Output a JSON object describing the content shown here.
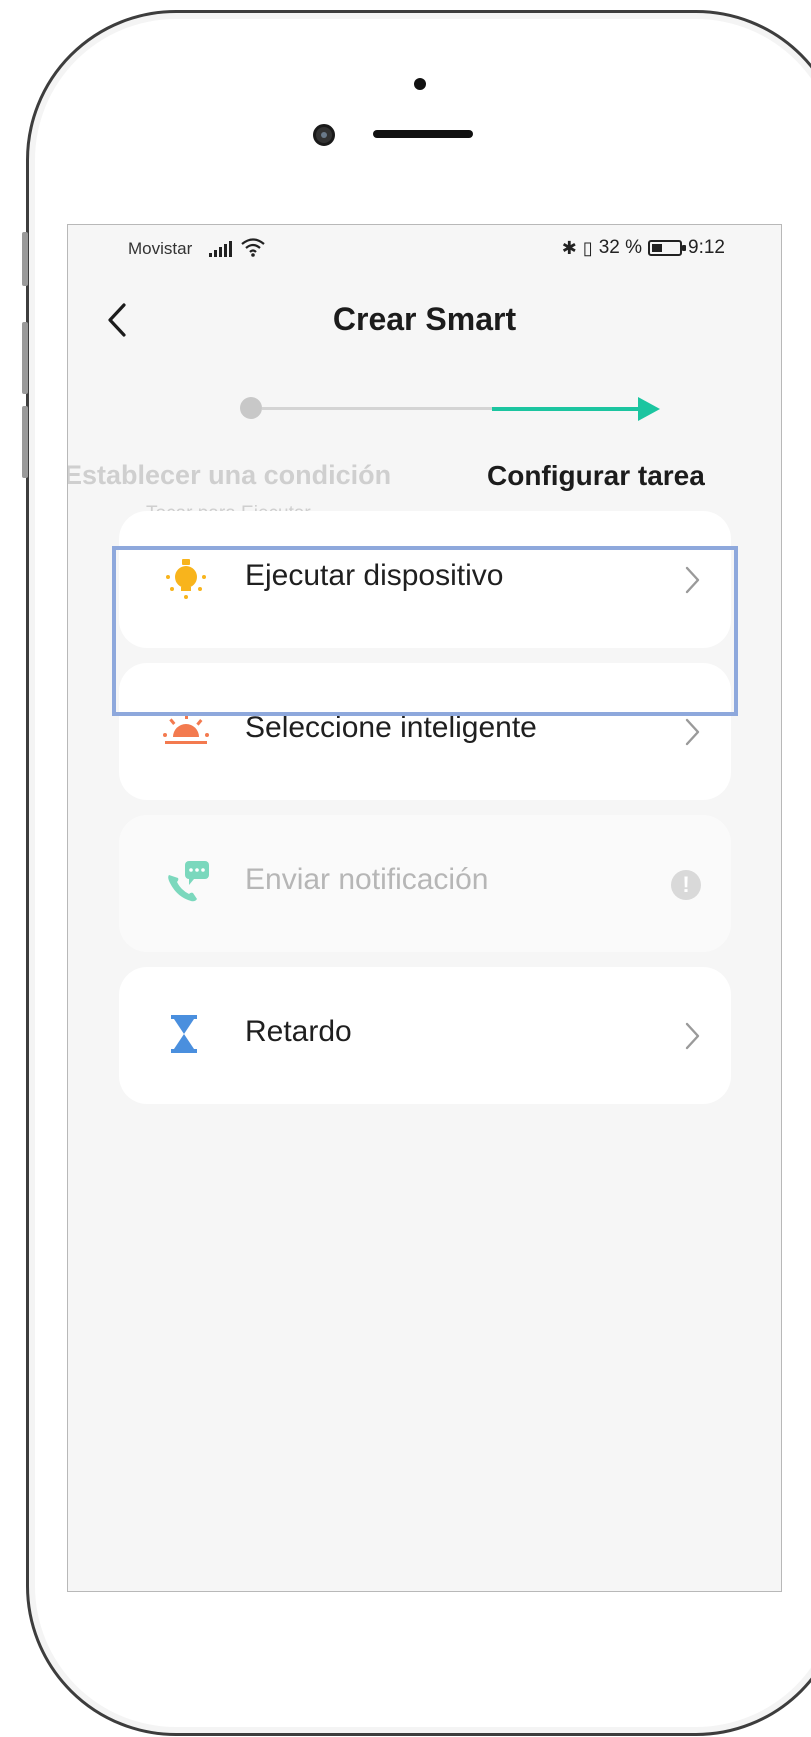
{
  "status_bar": {
    "carrier": "Movistar",
    "battery_text": "32 %",
    "time": "9:12"
  },
  "header": {
    "title": "Crear Smart"
  },
  "steps": {
    "step1_label": "Establecer una condición",
    "step1_sub": "Tocar para Ejecutar",
    "step2_label": "Configurar tarea"
  },
  "options": [
    {
      "label": "Ejecutar dispositivo",
      "icon": "lightbulb-icon",
      "enabled": true
    },
    {
      "label": "Seleccione inteligente",
      "icon": "sunrise-icon",
      "enabled": true
    },
    {
      "label": "Enviar notificación",
      "icon": "phone-message-icon",
      "enabled": false
    },
    {
      "label": "Retardo",
      "icon": "hourglass-icon",
      "enabled": true
    }
  ],
  "colors": {
    "accent_green": "#1bc5a0",
    "bulb_yellow": "#f8b41c",
    "sunrise_orange": "#f37a4f",
    "notify_teal": "#4fc9a8",
    "hourglass_blue": "#4a8fde",
    "highlight_border": "#8ea8dc"
  }
}
